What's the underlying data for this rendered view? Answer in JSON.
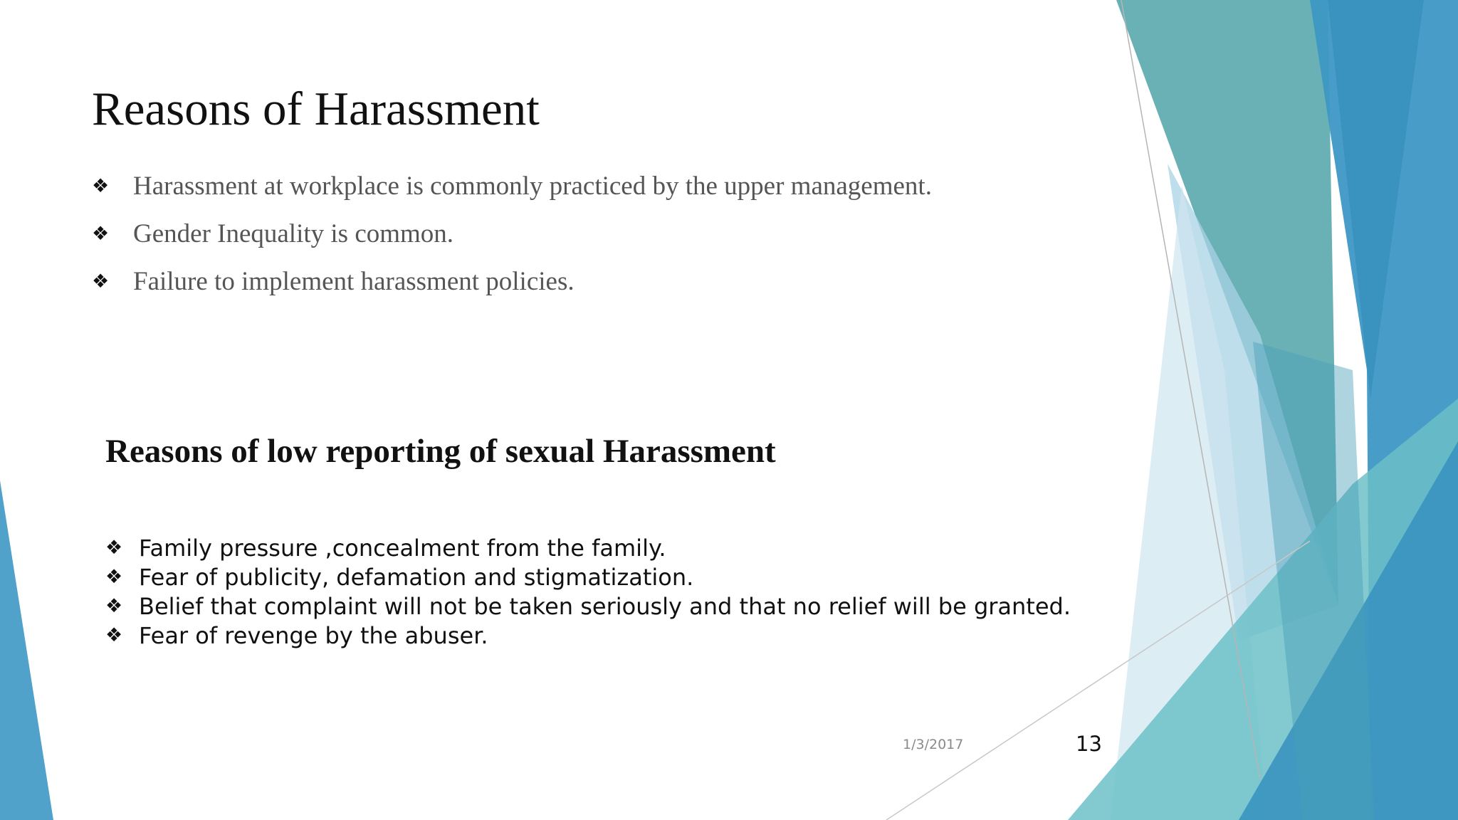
{
  "slide": {
    "title": "Reasons of Harassment",
    "top_bullets": [
      "Harassment at workplace is commonly practiced by the upper management.",
      "Gender Inequality  is common.",
      "Failure to implement harassment policies."
    ],
    "subtitle": "Reasons of low reporting of sexual Harassment",
    "bottom_bullets": [
      "Family pressure ,concealment from the family.",
      "Fear of publicity, defamation and stigmatization.",
      "Belief that complaint will not be taken seriously and that no relief will be granted.",
      "Fear of revenge by the abuser."
    ],
    "bullet_glyph": "❖",
    "footer": {
      "date": "1/3/2017",
      "slide_number": "13"
    }
  },
  "theme": {
    "background": "#ffffff",
    "accent_teal": "#5aa8ad",
    "accent_blue": "#3d98c4",
    "accent_light_blue": "#a9d3e6",
    "accent_cyan": "#6cc0c8"
  }
}
